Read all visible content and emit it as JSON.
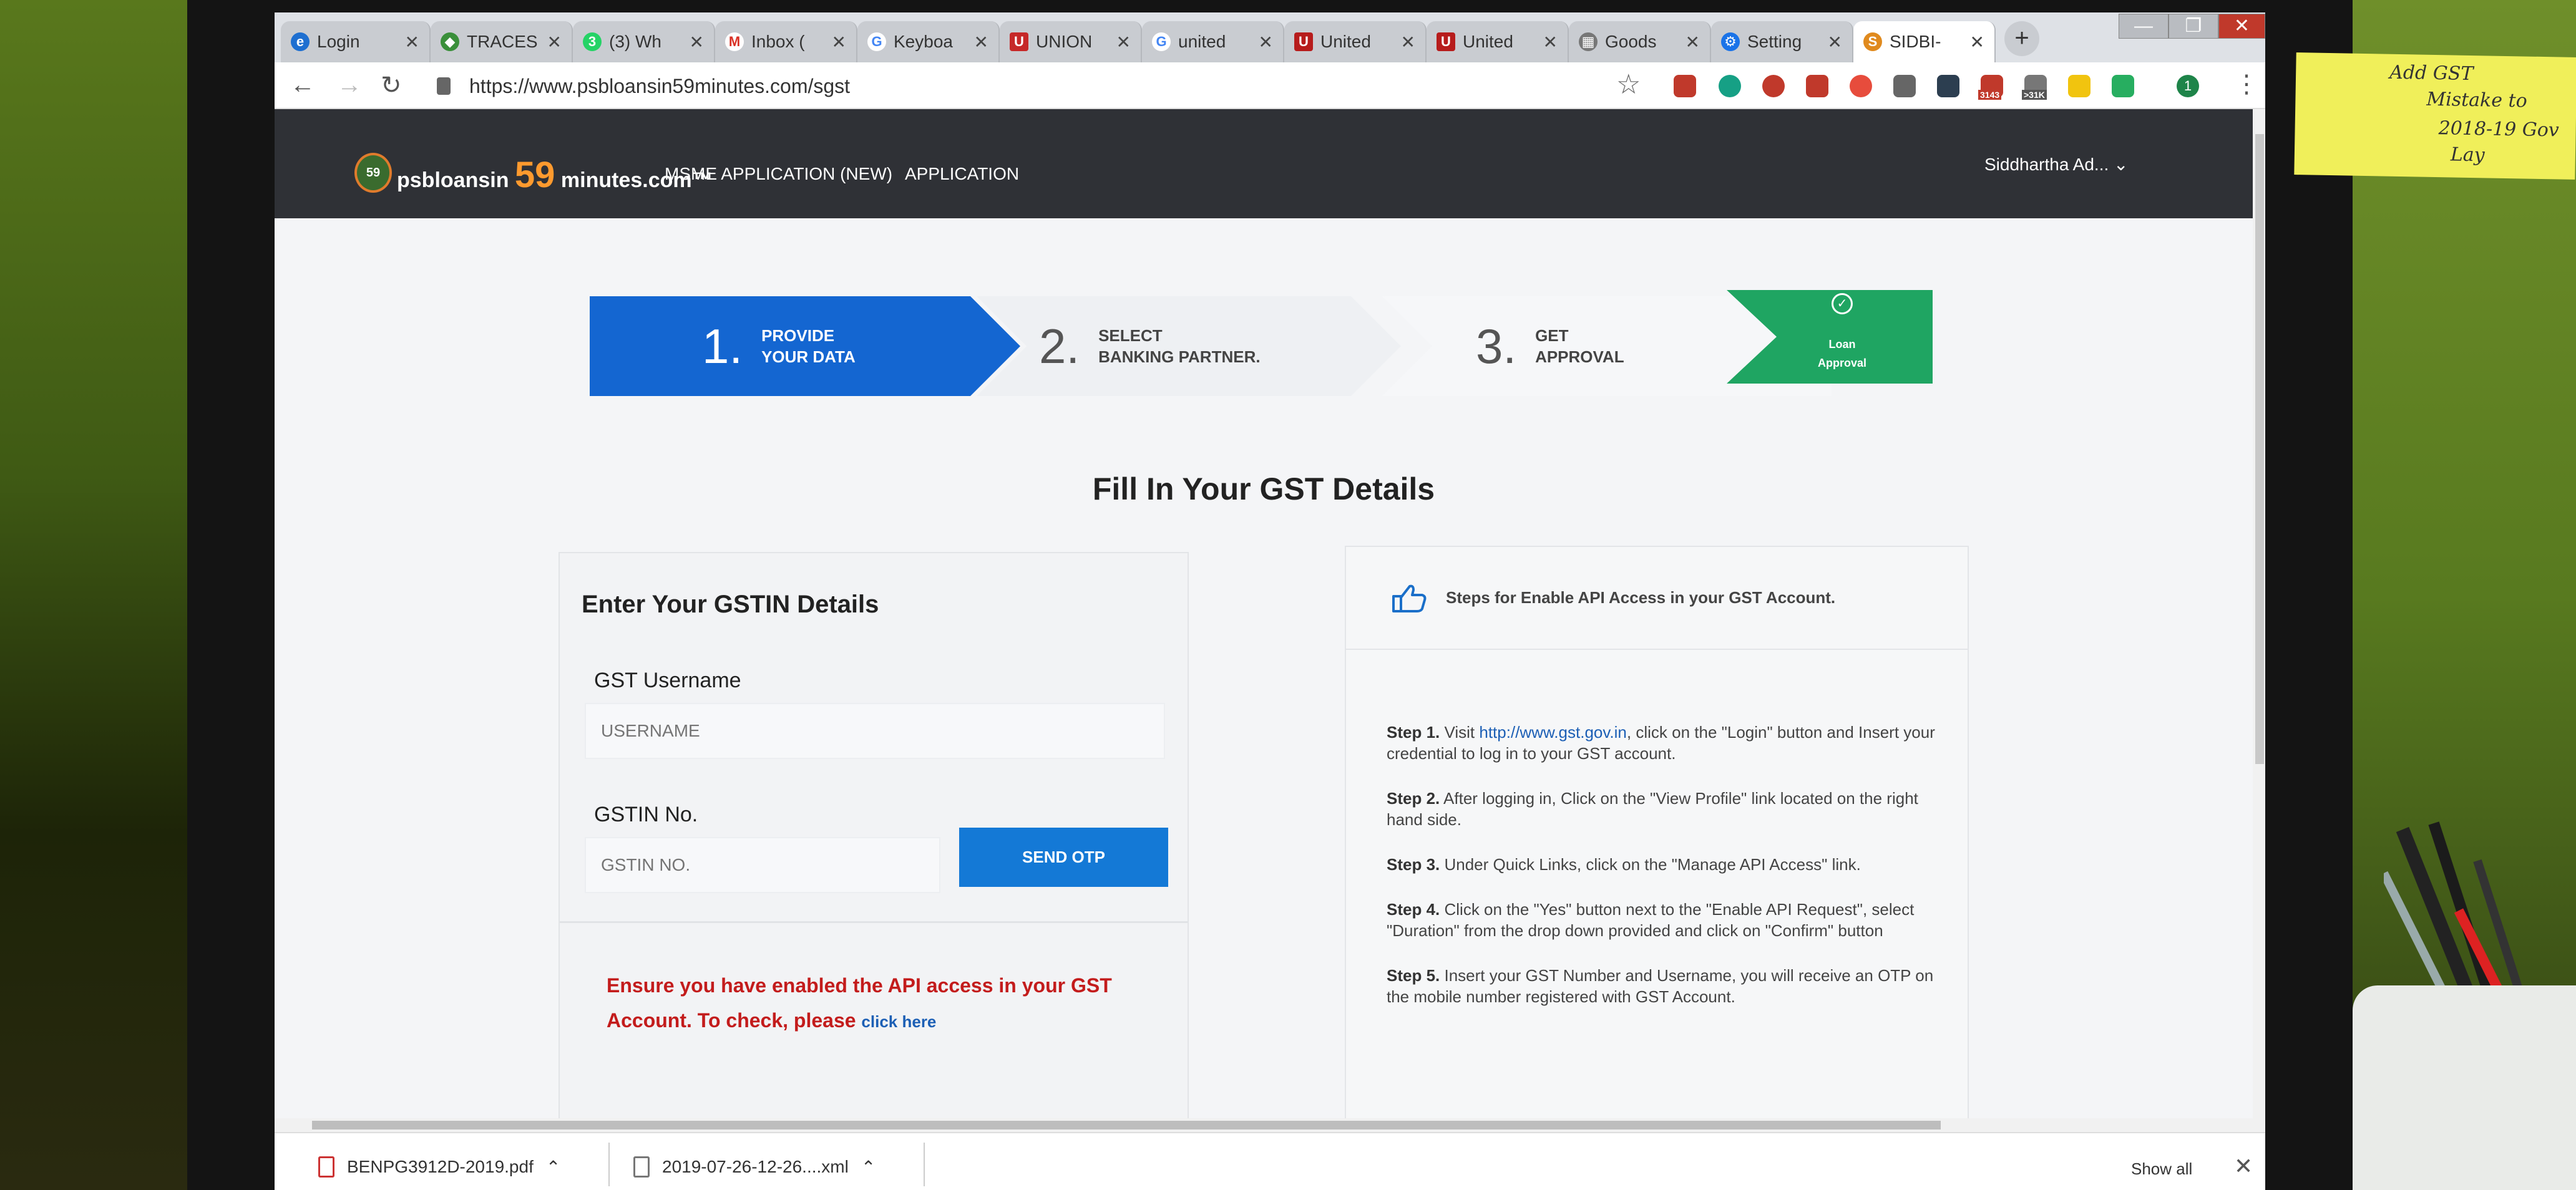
{
  "browser": {
    "tabs": [
      {
        "label": "Login",
        "icon": "ie-icon",
        "color": "#1e6fd0"
      },
      {
        "label": "TRACES",
        "icon": "traces-icon",
        "color": "#3a8f3a"
      },
      {
        "label": "(3) Wh",
        "icon": "whatsapp-icon",
        "color": "#25d366"
      },
      {
        "label": "Inbox (",
        "icon": "gmail-icon",
        "color": "#d93025"
      },
      {
        "label": "Keyboa",
        "icon": "google-icon",
        "color": "#4285f4"
      },
      {
        "label": "UNION",
        "icon": "union-bank-icon",
        "color": "#c62828"
      },
      {
        "label": "united",
        "icon": "google-icon",
        "color": "#4285f4"
      },
      {
        "label": "United",
        "icon": "united-icon",
        "color": "#b71c1c"
      },
      {
        "label": "United",
        "icon": "united-icon",
        "color": "#b71c1c"
      },
      {
        "label": "Goods",
        "icon": "goods-icon",
        "color": "#777777"
      },
      {
        "label": "Setting",
        "icon": "gear-icon",
        "color": "#1a73e8"
      },
      {
        "label": "SIDBI-",
        "icon": "sidbi-icon",
        "color": "#e08a1e"
      }
    ],
    "url": "https://www.psbloansin59minutes.com/sgst",
    "extensions": {
      "badge1": "3143",
      "badge2": ">31K",
      "profile": "1"
    },
    "window_controls": {
      "minimize": "—",
      "restore": "❐",
      "close": "✕"
    }
  },
  "site": {
    "logo_badge": "59",
    "logo_prefix": "psbloansin",
    "logo_number": "59",
    "logo_suffix": "minutes.com™",
    "nav_msme": "MSME APPLICATION (NEW)",
    "nav_application": "APPLICATION",
    "user": "Siddhartha Ad..."
  },
  "stepper": {
    "step1": {
      "num": "1.",
      "line1": "PROVIDE",
      "line2": "YOUR DATA"
    },
    "step2": {
      "num": "2.",
      "line1": "SELECT",
      "line2": "BANKING PARTNER."
    },
    "step3": {
      "num": "3.",
      "line1": "GET",
      "line2": "APPROVAL"
    },
    "step4": {
      "line1": "Loan",
      "line2": "Approval"
    }
  },
  "form": {
    "page_title": "Fill In Your GST Details",
    "card_title": "Enter Your GSTIN Details",
    "username_label": "GST Username",
    "username_placeholder": "USERNAME",
    "gstin_label": "GSTIN No.",
    "gstin_placeholder": "GSTIN NO.",
    "send_otp": "SEND OTP",
    "warning": "Ensure you have enabled the API access in your GST Account. To check, please",
    "warning_link": "click here"
  },
  "instructions": {
    "title": "Steps for Enable API Access in your GST Account.",
    "steps": [
      {
        "label": "Step 1.",
        "text_before": "Visit",
        "link": "http://www.gst.gov.in",
        "text": ", click on the \"Login\" button and Insert your credential to log in to your GST account."
      },
      {
        "label": "Step 2.",
        "text": "After logging in, Click on the \"View Profile\" link located on the right hand side."
      },
      {
        "label": "Step 3.",
        "text": "Under Quick Links, click on the \"Manage API Access\" link."
      },
      {
        "label": "Step 4.",
        "text": "Click on the \"Yes\" button next to the \"Enable API Request\", select \"Duration\" from the drop down provided and click on \"Confirm\" button"
      },
      {
        "label": "Step 5.",
        "text": "Insert your GST Number and Username, you will receive an OTP on the mobile number registered with GST Account."
      }
    ]
  },
  "downloads": {
    "item1": "BENPG3912D-2019.pdf",
    "item2": "2019-07-26-12-26....xml",
    "show_all": "Show all"
  },
  "note": {
    "line1": "Add GST",
    "line2": "Mistake to",
    "line3": "2018-19 Gov",
    "line4": "Lay"
  },
  "colors": {
    "primary_blue": "#1466d1",
    "success_green": "#1fa562",
    "header_dark": "#2f3136",
    "warning_red": "#c31c1c"
  }
}
